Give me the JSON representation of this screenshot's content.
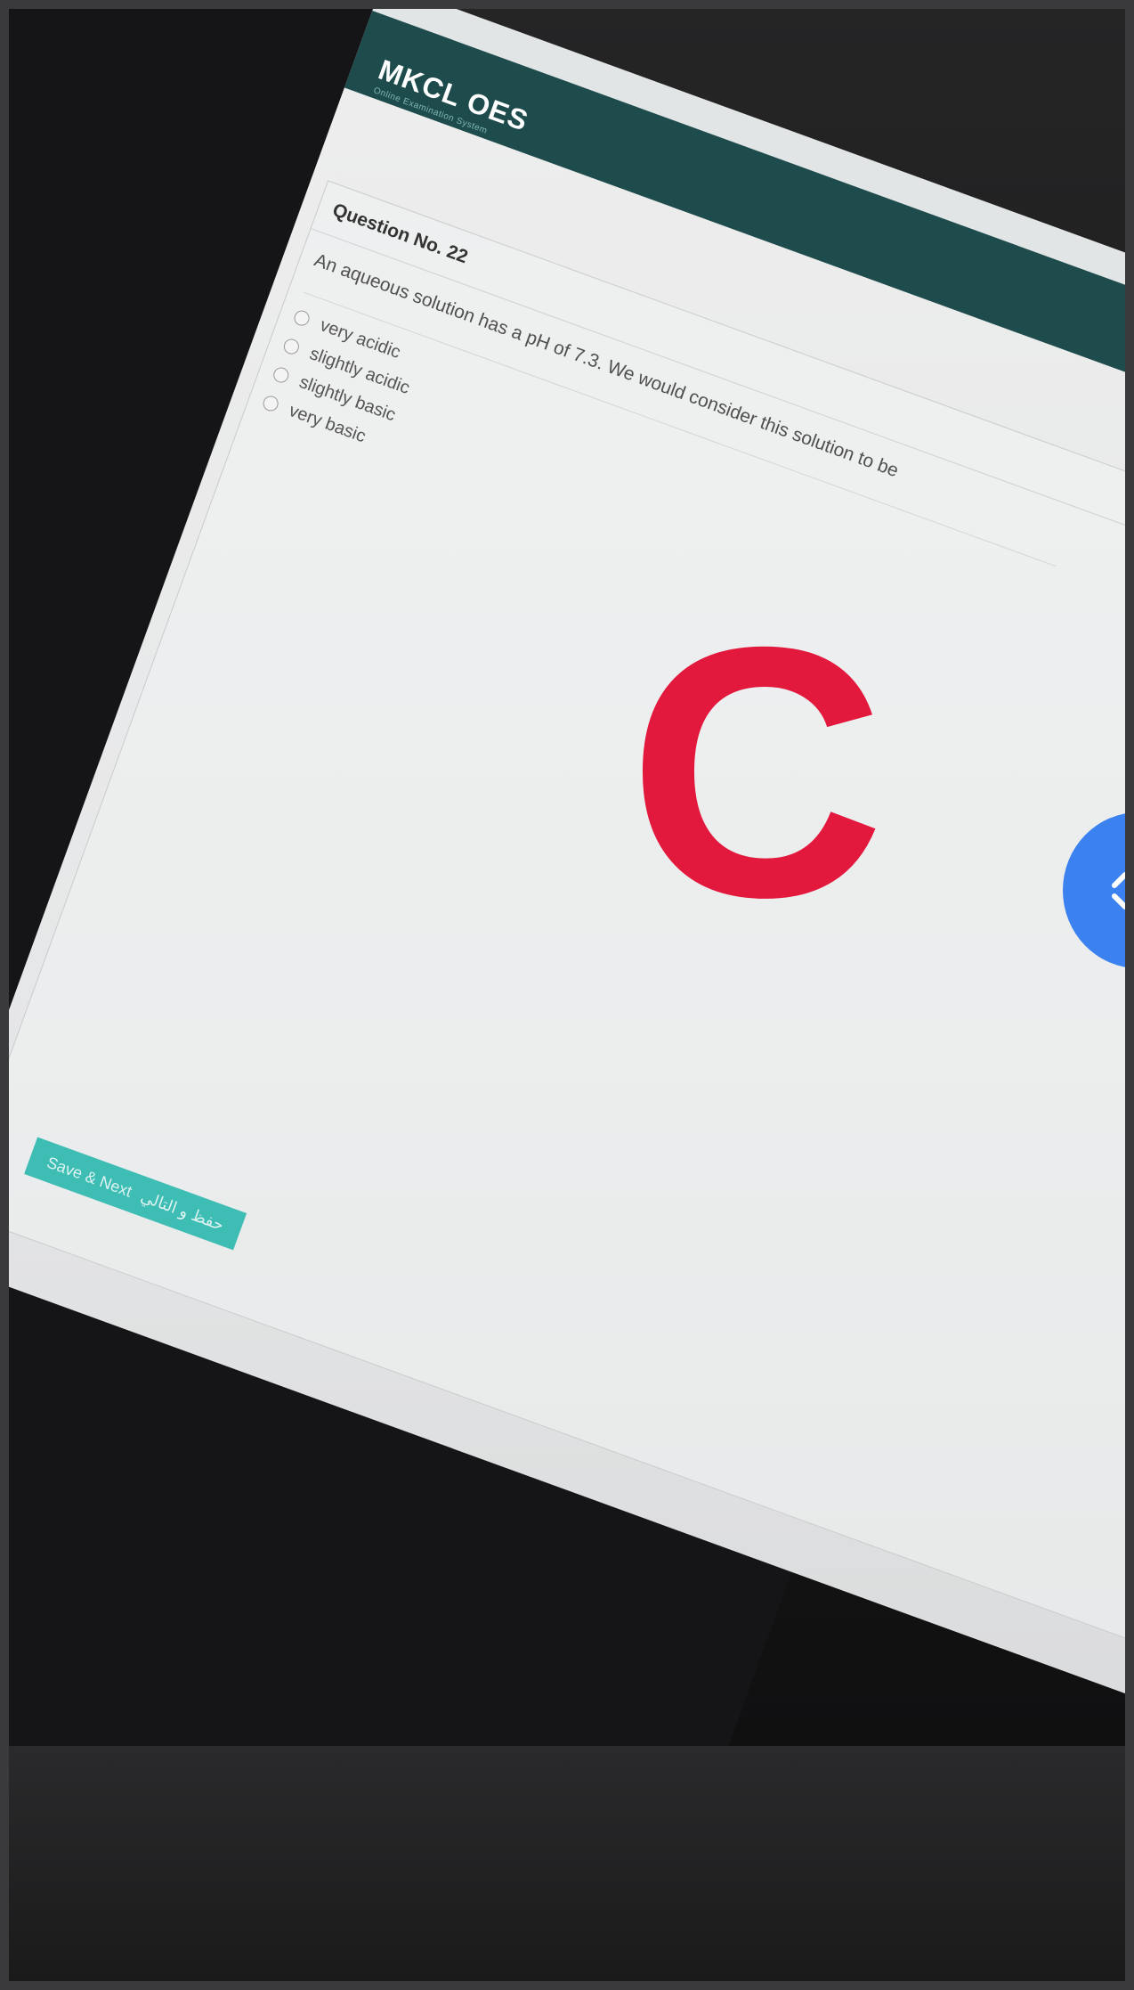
{
  "app": {
    "logo_title": "MKCL OES",
    "logo_subtitle": "Online Examination System"
  },
  "question": {
    "number_label": "Question No. 22",
    "text": "An aqueous solution has a pH of 7.3. We would consider this solution to be",
    "options": [
      {
        "label": "very acidic",
        "selected": false
      },
      {
        "label": "slightly acidic",
        "selected": false
      },
      {
        "label": "slightly basic",
        "selected": false
      },
      {
        "label": "very basic",
        "selected": false
      }
    ]
  },
  "actions": {
    "save_next_label": "Save & Next",
    "save_next_arabic": "حفظ و التالي"
  },
  "overlay": {
    "answer_letter": "C",
    "answer_color": "#e3183d"
  },
  "colors": {
    "header": "#1e4b4b",
    "button": "#3ebdb4",
    "fab": "#3b82f0"
  },
  "icons": {
    "side_fab": "expand-arrows-icon"
  }
}
